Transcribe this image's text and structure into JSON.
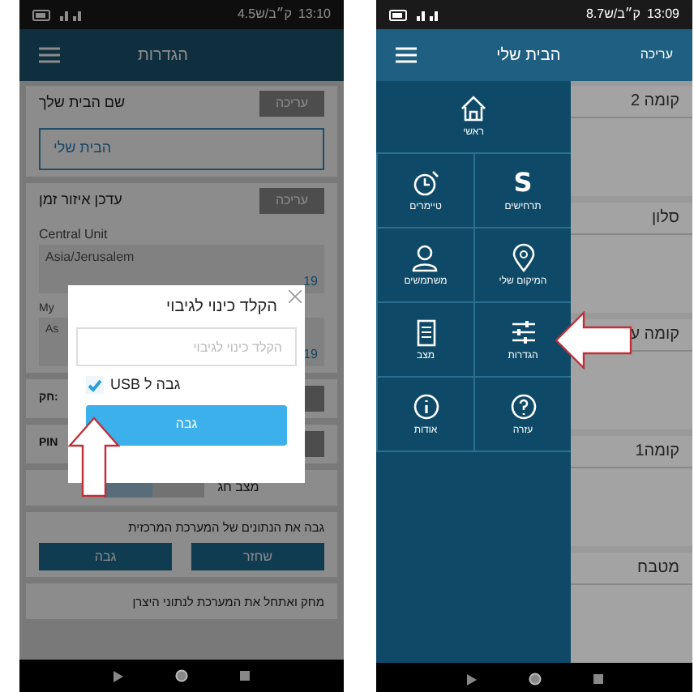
{
  "left_screen": {
    "status_bar": {
      "time": "13:10",
      "speed": "4.5ק״ב/ש"
    },
    "header": {
      "title": "הגדרות"
    },
    "home_name": {
      "label": "שם הבית שלך",
      "edit_button": "עריכה",
      "value": "הבית שלי"
    },
    "timezone": {
      "label": "עדכן איזור זמן",
      "edit_button": "עריכה",
      "central_label": "Central Unit",
      "central_value": "Asia/Jerusalem",
      "central_time": "19",
      "my_label": "My",
      "my_value": "As",
      "my_time": "19"
    },
    "hidden_rows": [
      {
        "label": "חק:"
      },
      {
        "label": "PIN"
      }
    ],
    "holiday": {
      "label": "מצב חג",
      "on": false
    },
    "backup": {
      "label": "גבה את הנתונים של המערכת המרכזית",
      "buttons": [
        "שחזר",
        "גבה"
      ]
    },
    "reset": {
      "label": "מחק ואתחל את המערכת לנתוני היצרן"
    },
    "dialog": {
      "title": "הקלד כינוי לגיבוי",
      "placeholder": "הקלד כינוי לגיבוי",
      "checkbox": {
        "label": "גבה ל USB",
        "checked": true
      },
      "button": "גבה"
    }
  },
  "right_screen": {
    "status_bar": {
      "time": "13:09",
      "speed": "8.7ק״ב/ש"
    },
    "header": {
      "title": "הבית שלי",
      "edit": "עריכה"
    },
    "menu": [
      {
        "kind": "home",
        "label": "ראשי"
      },
      {
        "kind": "scenes",
        "label": "תרחישים",
        "icon_text": "S"
      },
      {
        "kind": "timers",
        "label": "טיימרים"
      },
      {
        "kind": "location",
        "label": "המיקום שלי"
      },
      {
        "kind": "users",
        "label": "משתמשים"
      },
      {
        "kind": "settings",
        "label": "הגדרות"
      },
      {
        "kind": "status",
        "label": "מצב"
      },
      {
        "kind": "help",
        "label": "עזרה"
      },
      {
        "kind": "about",
        "label": "אודות"
      }
    ],
    "rooms": [
      "קומה 2",
      "סלון",
      "קומה ע",
      "קומה1",
      "מטבח"
    ]
  }
}
